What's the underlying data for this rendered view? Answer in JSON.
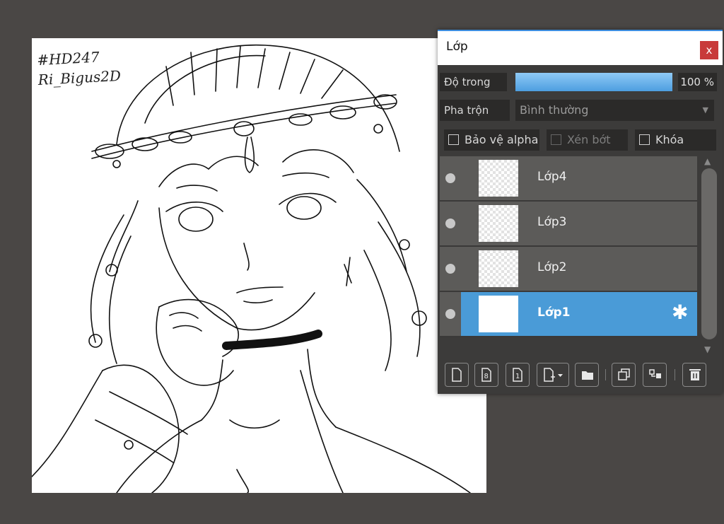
{
  "canvas": {
    "signature_line1": "#HD247",
    "signature_line2": "Ri_Bigus2D"
  },
  "panel": {
    "title": "Lớp",
    "close_label": "x",
    "opacity_label": "Độ trong",
    "opacity_value": "100 %",
    "opacity_fraction": 1.0,
    "blend_label": "Pha trộn",
    "blend_value": "Bình thường",
    "protect_alpha_label": "Bảo vệ alpha",
    "clipping_label": "Xén bớt",
    "lock_label": "Khóa"
  },
  "layers": [
    {
      "name": "Lớp4",
      "selected": false
    },
    {
      "name": "Lớp3",
      "selected": false
    },
    {
      "name": "Lớp2",
      "selected": false
    },
    {
      "name": "Lớp1",
      "selected": true
    }
  ],
  "colors": {
    "accent": "#4a9bd7",
    "close": "#c83a3a",
    "background": "#4a4745"
  }
}
